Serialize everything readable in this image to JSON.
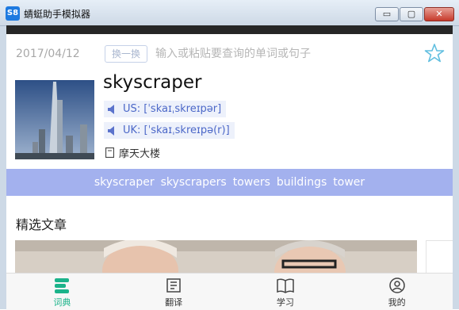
{
  "window": {
    "title": "蜻蜓助手模拟器",
    "min_label": "▭",
    "max_label": "▢",
    "close_label": "✕"
  },
  "search": {
    "date": "2017/04/12",
    "switch_label": "换一换",
    "placeholder": "输入或粘贴要查询的单词或句子"
  },
  "entry": {
    "word": "skyscraper",
    "us": "US: [ˈskaɪˌskreɪpər]",
    "uk": "UK: [ˈskaɪˌskreɪpə(r)]",
    "meaning": "摩天大楼"
  },
  "synonyms": [
    "skyscraper",
    "skyscrapers",
    "towers",
    "buildings",
    "tower"
  ],
  "section": {
    "title": "精选文章"
  },
  "tabs": [
    {
      "label": "词典",
      "icon": "dictionary-icon"
    },
    {
      "label": "翻译",
      "icon": "translate-icon"
    },
    {
      "label": "学习",
      "icon": "book-icon"
    },
    {
      "label": "我的",
      "icon": "profile-icon"
    }
  ],
  "colors": {
    "accent": "#1bb38a",
    "pron_text": "#4c68c8",
    "synonym_bar": "#a3b1ee"
  }
}
